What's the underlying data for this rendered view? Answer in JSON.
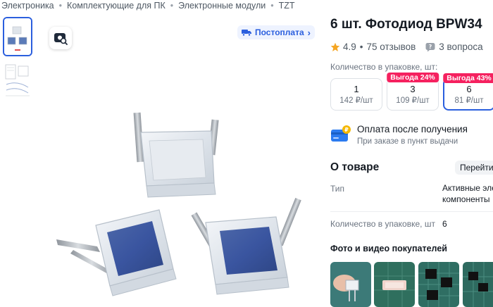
{
  "breadcrumb": [
    "Электроника",
    "Комплектующие для ПК",
    "Электронные модули",
    "TZT"
  ],
  "postpay_label": "Постоплата",
  "product": {
    "title": "6 шт. Фотодиод BPW34",
    "rating": "4.9",
    "reviews": "75 отзывов",
    "questions": "3 вопроса"
  },
  "qty_label": "Количество в упаковке, шт:",
  "packs": [
    {
      "qty": "1",
      "price": "142 ₽/шт",
      "badge": ""
    },
    {
      "qty": "3",
      "price": "109 ₽/шт",
      "badge": "Выгода 24%"
    },
    {
      "qty": "6",
      "price": "81 ₽/шт",
      "badge": "Выгода 43%"
    }
  ],
  "payment": {
    "title": "Оплата после получения",
    "subtitle": "При заказе в пункт выдачи"
  },
  "about": {
    "title": "О товаре",
    "goto_label": "Перейти",
    "attributes": [
      {
        "key": "Тип",
        "value": "Активные эле компоненты"
      },
      {
        "key": "Количество в упаковке, шт",
        "value": "6"
      }
    ]
  },
  "photos_title": "Фото и видео покупателей",
  "colors": {
    "accent": "#2b5fde",
    "badge": "#f5215f",
    "star": "#f5a623"
  }
}
